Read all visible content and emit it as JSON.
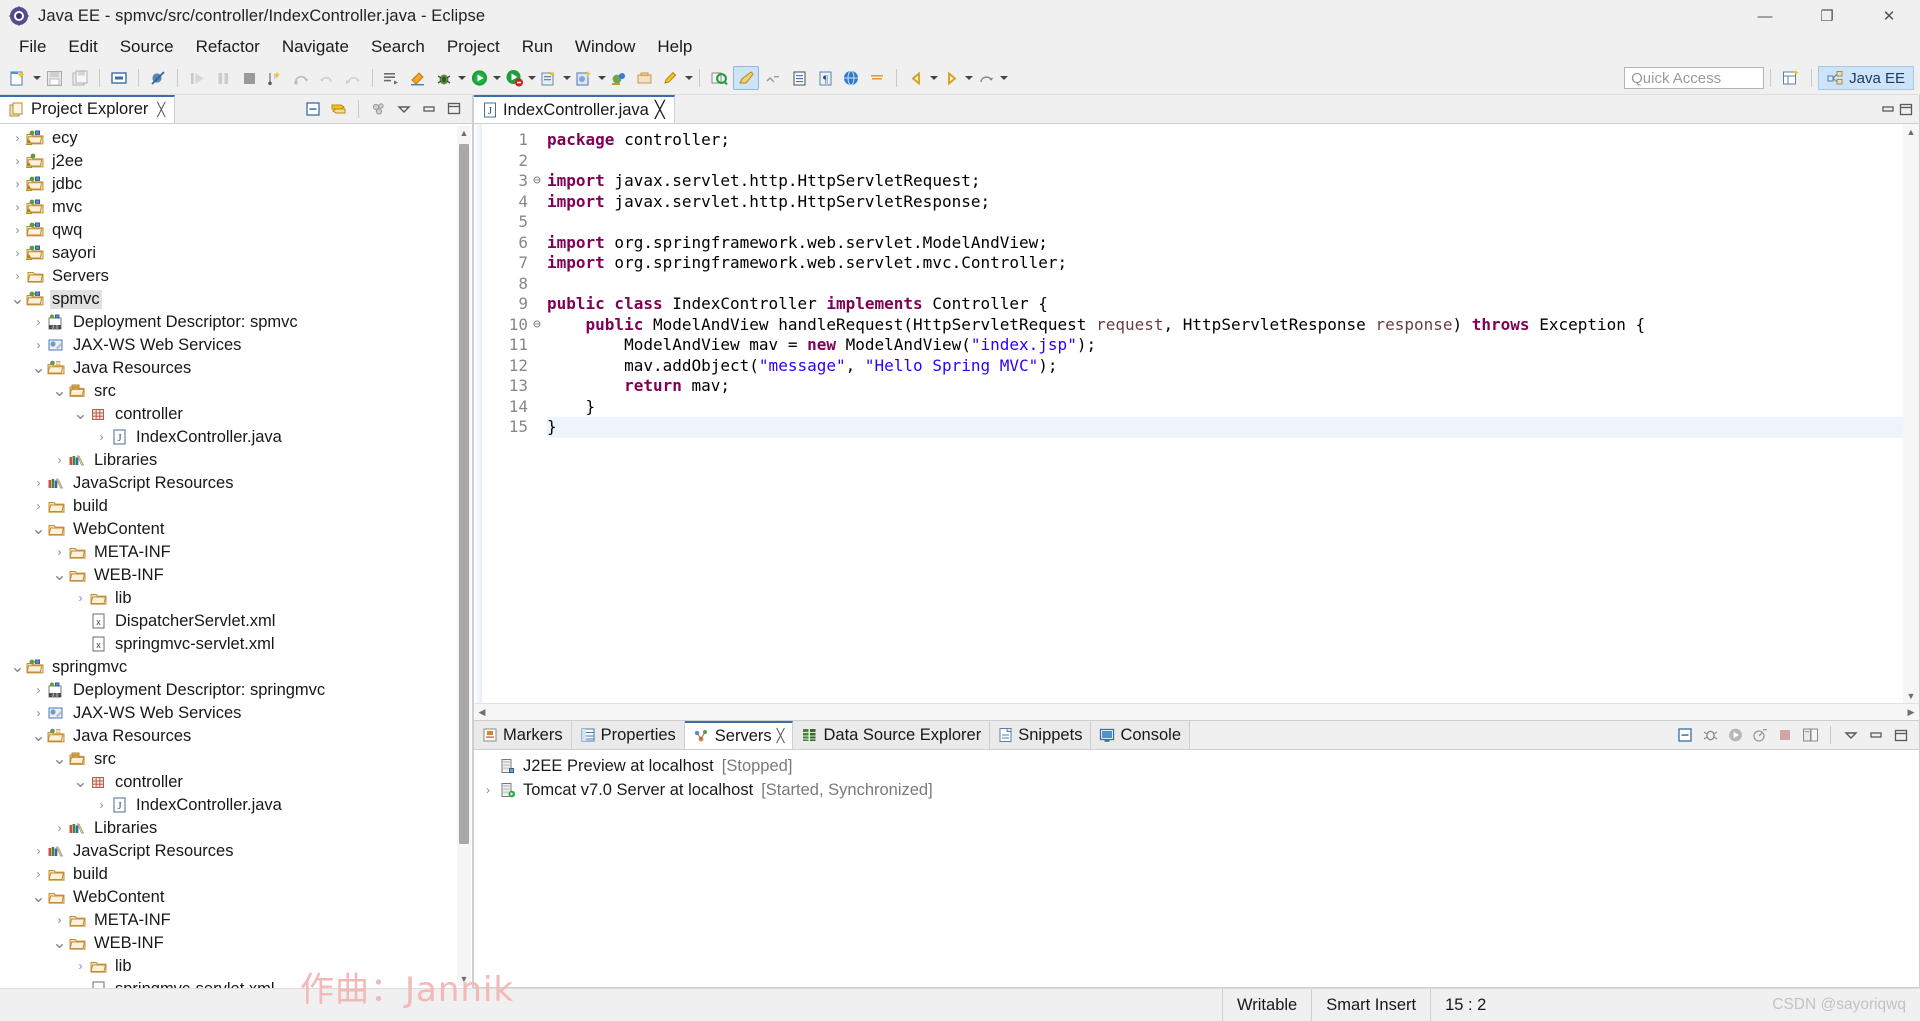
{
  "window": {
    "title": "Java EE - spmvc/src/controller/IndexController.java - Eclipse",
    "app_icon": "eclipse-icon",
    "minimize": "—",
    "maximize": "❐",
    "close": "✕"
  },
  "menubar": {
    "items": [
      "File",
      "Edit",
      "Source",
      "Refactor",
      "Navigate",
      "Search",
      "Project",
      "Run",
      "Window",
      "Help"
    ]
  },
  "toolbar": {
    "quick_access_placeholder": "Quick Access",
    "open_perspective_label": "open-perspective-icon",
    "perspective_label": "Java EE",
    "buttons": [
      "new-wizard-icon",
      "new-dropdown-caret",
      "save-icon",
      "save-all-icon",
      "print-icon",
      "skip-breakpoints-icon",
      "resume-icon",
      "suspend-icon",
      "terminate-icon",
      "step-into-icon",
      "step-over-icon",
      "step-return-icon",
      "drop-to-frame-icon",
      "open-type-icon",
      "open-task-icon",
      "debug-icon",
      "debug-caret",
      "run-icon",
      "run-caret",
      "external-tools-icon",
      "external-tools-caret",
      "coverage-icon",
      "coverage-caret",
      "new-java-package-icon",
      "new-java-class-icon",
      "new-annotation-icon",
      "annotation-caret",
      "search-icon",
      "last-edit-icon",
      "next-annotation-icon",
      "previous-annotation-icon",
      "back-icon",
      "back-caret",
      "forward-icon",
      "forward-caret",
      "pin-editor-icon"
    ]
  },
  "project_explorer": {
    "tab_label": "Project Explorer",
    "tab_icon": "project-explorer-icon",
    "close_icon": "╳",
    "toolbar_icons": [
      "collapse-all-icon",
      "link-with-editor-icon",
      "view-menu-icon",
      "minimize-icon",
      "maximize-icon"
    ],
    "tree": [
      {
        "label": "ecy",
        "indent": 0,
        "arrow": "collapsed",
        "icon": "java-web-project-warning-icon"
      },
      {
        "label": "j2ee",
        "indent": 0,
        "arrow": "collapsed",
        "icon": "web-project-warning-icon"
      },
      {
        "label": "jdbc",
        "indent": 0,
        "arrow": "collapsed",
        "icon": "java-web-project-warning-icon"
      },
      {
        "label": "mvc",
        "indent": 0,
        "arrow": "collapsed",
        "icon": "java-web-project-warning-icon"
      },
      {
        "label": "qwq",
        "indent": 0,
        "arrow": "collapsed",
        "icon": "java-web-project-icon"
      },
      {
        "label": "sayori",
        "indent": 0,
        "arrow": "collapsed",
        "icon": "java-web-project-warning-icon"
      },
      {
        "label": "Servers",
        "indent": 0,
        "arrow": "collapsed",
        "icon": "folder-icon"
      },
      {
        "label": "spmvc",
        "indent": 0,
        "arrow": "expanded",
        "icon": "java-web-project-icon",
        "selected": true
      },
      {
        "label": "Deployment Descriptor: spmvc",
        "indent": 1,
        "arrow": "collapsed",
        "icon": "deployment-descriptor-icon"
      },
      {
        "label": "JAX-WS Web Services",
        "indent": 1,
        "arrow": "collapsed",
        "icon": "jax-ws-icon"
      },
      {
        "label": "Java Resources",
        "indent": 1,
        "arrow": "expanded",
        "icon": "java-resources-icon"
      },
      {
        "label": "src",
        "indent": 2,
        "arrow": "expanded",
        "icon": "source-folder-icon"
      },
      {
        "label": "controller",
        "indent": 3,
        "arrow": "expanded",
        "icon": "package-icon"
      },
      {
        "label": "IndexController.java",
        "indent": 4,
        "arrow": "collapsed",
        "icon": "java-file-icon"
      },
      {
        "label": "Libraries",
        "indent": 2,
        "arrow": "collapsed",
        "icon": "libraries-icon"
      },
      {
        "label": "JavaScript Resources",
        "indent": 1,
        "arrow": "collapsed",
        "icon": "libraries-icon"
      },
      {
        "label": "build",
        "indent": 1,
        "arrow": "collapsed",
        "icon": "folder-icon"
      },
      {
        "label": "WebContent",
        "indent": 1,
        "arrow": "expanded",
        "icon": "folder-icon"
      },
      {
        "label": "META-INF",
        "indent": 2,
        "arrow": "collapsed",
        "icon": "folder-icon"
      },
      {
        "label": "WEB-INF",
        "indent": 2,
        "arrow": "expanded",
        "icon": "folder-icon"
      },
      {
        "label": "lib",
        "indent": 3,
        "arrow": "collapsed",
        "icon": "folder-icon"
      },
      {
        "label": "DispatcherServlet.xml",
        "indent": 3,
        "arrow": "none",
        "icon": "xml-file-icon"
      },
      {
        "label": "springmvc-servlet.xml",
        "indent": 3,
        "arrow": "none",
        "icon": "xml-file-icon"
      },
      {
        "label": "springmvc",
        "indent": 0,
        "arrow": "expanded",
        "icon": "java-web-project-icon"
      },
      {
        "label": "Deployment Descriptor: springmvc",
        "indent": 1,
        "arrow": "collapsed",
        "icon": "deployment-descriptor-icon"
      },
      {
        "label": "JAX-WS Web Services",
        "indent": 1,
        "arrow": "collapsed",
        "icon": "jax-ws-icon"
      },
      {
        "label": "Java Resources",
        "indent": 1,
        "arrow": "expanded",
        "icon": "java-resources-icon"
      },
      {
        "label": "src",
        "indent": 2,
        "arrow": "expanded",
        "icon": "source-folder-icon"
      },
      {
        "label": "controller",
        "indent": 3,
        "arrow": "expanded",
        "icon": "package-icon"
      },
      {
        "label": "IndexController.java",
        "indent": 4,
        "arrow": "collapsed",
        "icon": "java-file-icon"
      },
      {
        "label": "Libraries",
        "indent": 2,
        "arrow": "collapsed",
        "icon": "libraries-icon"
      },
      {
        "label": "JavaScript Resources",
        "indent": 1,
        "arrow": "collapsed",
        "icon": "libraries-icon"
      },
      {
        "label": "build",
        "indent": 1,
        "arrow": "collapsed",
        "icon": "folder-icon"
      },
      {
        "label": "WebContent",
        "indent": 1,
        "arrow": "expanded",
        "icon": "folder-icon"
      },
      {
        "label": "META-INF",
        "indent": 2,
        "arrow": "collapsed",
        "icon": "folder-icon"
      },
      {
        "label": "WEB-INF",
        "indent": 2,
        "arrow": "expanded",
        "icon": "folder-icon"
      },
      {
        "label": "lib",
        "indent": 3,
        "arrow": "collapsed",
        "icon": "folder-icon"
      },
      {
        "label": "springmvc-servlet.xml",
        "indent": 3,
        "arrow": "none",
        "icon": "xml-file-icon"
      }
    ]
  },
  "editor": {
    "tab_label": "IndexController.java",
    "tab_icon": "java-file-icon",
    "close_icon": "╳",
    "lines": [
      {
        "n": "1",
        "fold": "",
        "hl": false,
        "tokens": [
          {
            "t": "package",
            "c": "kw"
          },
          {
            "t": " controller;",
            "c": ""
          }
        ]
      },
      {
        "n": "2",
        "fold": "",
        "hl": false,
        "tokens": []
      },
      {
        "n": "3",
        "fold": "⊖",
        "hl": false,
        "tokens": [
          {
            "t": "import",
            "c": "kw"
          },
          {
            "t": " javax.servlet.http.HttpServletRequest;",
            "c": ""
          }
        ]
      },
      {
        "n": "4",
        "fold": "",
        "hl": false,
        "tokens": [
          {
            "t": "import",
            "c": "kw"
          },
          {
            "t": " javax.servlet.http.HttpServletResponse;",
            "c": ""
          }
        ]
      },
      {
        "n": "5",
        "fold": "",
        "hl": false,
        "tokens": []
      },
      {
        "n": "6",
        "fold": "",
        "hl": false,
        "tokens": [
          {
            "t": "import",
            "c": "kw"
          },
          {
            "t": " org.springframework.web.servlet.ModelAndView;",
            "c": ""
          }
        ]
      },
      {
        "n": "7",
        "fold": "",
        "hl": false,
        "tokens": [
          {
            "t": "import",
            "c": "kw"
          },
          {
            "t": " org.springframework.web.servlet.mvc.Controller;",
            "c": ""
          }
        ]
      },
      {
        "n": "8",
        "fold": "",
        "hl": false,
        "tokens": []
      },
      {
        "n": "9",
        "fold": "",
        "hl": false,
        "tokens": [
          {
            "t": "public class",
            "c": "kw"
          },
          {
            "t": " IndexController ",
            "c": ""
          },
          {
            "t": "implements",
            "c": "kw"
          },
          {
            "t": " Controller {",
            "c": ""
          }
        ]
      },
      {
        "n": "10",
        "fold": "⊖",
        "hl": false,
        "tokens": [
          {
            "t": "    ",
            "c": ""
          },
          {
            "t": "public",
            "c": "kw"
          },
          {
            "t": " ModelAndView handleRequest(HttpServletRequest ",
            "c": ""
          },
          {
            "t": "request",
            "c": "par"
          },
          {
            "t": ", HttpServletResponse ",
            "c": ""
          },
          {
            "t": "response",
            "c": "par"
          },
          {
            "t": ") ",
            "c": ""
          },
          {
            "t": "throws",
            "c": "kw"
          },
          {
            "t": " Exception {",
            "c": ""
          }
        ]
      },
      {
        "n": "11",
        "fold": "",
        "hl": false,
        "tokens": [
          {
            "t": "        ModelAndView mav = ",
            "c": ""
          },
          {
            "t": "new",
            "c": "kw"
          },
          {
            "t": " ModelAndView(",
            "c": ""
          },
          {
            "t": "\"index.jsp\"",
            "c": "str"
          },
          {
            "t": ");",
            "c": ""
          }
        ]
      },
      {
        "n": "12",
        "fold": "",
        "hl": false,
        "tokens": [
          {
            "t": "        mav.addObject(",
            "c": ""
          },
          {
            "t": "\"message\"",
            "c": "str"
          },
          {
            "t": ", ",
            "c": ""
          },
          {
            "t": "\"Hello Spring MVC\"",
            "c": "str"
          },
          {
            "t": ");",
            "c": ""
          }
        ]
      },
      {
        "n": "13",
        "fold": "",
        "hl": false,
        "tokens": [
          {
            "t": "        ",
            "c": ""
          },
          {
            "t": "return",
            "c": "kw"
          },
          {
            "t": " mav;",
            "c": ""
          }
        ]
      },
      {
        "n": "14",
        "fold": "",
        "hl": false,
        "tokens": [
          {
            "t": "    }",
            "c": ""
          }
        ]
      },
      {
        "n": "15",
        "fold": "",
        "hl": true,
        "tokens": [
          {
            "t": "}",
            "c": ""
          }
        ]
      }
    ]
  },
  "bottom_panel": {
    "tabs": [
      {
        "label": "Markers",
        "icon": "markers-icon",
        "active": false
      },
      {
        "label": "Properties",
        "icon": "properties-icon",
        "active": false
      },
      {
        "label": "Servers",
        "icon": "servers-icon",
        "active": true,
        "close_icon": "╳"
      },
      {
        "label": "Data Source Explorer",
        "icon": "data-source-icon",
        "active": false
      },
      {
        "label": "Snippets",
        "icon": "snippets-icon",
        "active": false
      },
      {
        "label": "Console",
        "icon": "console-icon",
        "active": false
      }
    ],
    "toolbar_icons": [
      "collapse-all-icon",
      "debug-server-icon",
      "start-server-icon",
      "profile-server-icon",
      "stop-server-icon",
      "publish-icon",
      "view-menu-icon",
      "minimize-icon",
      "maximize-icon"
    ],
    "servers": [
      {
        "name": "J2EE Preview at localhost",
        "state": "[Stopped]",
        "arrow": "none",
        "icon": "server-stopped-icon"
      },
      {
        "name": "Tomcat v7.0 Server at localhost",
        "state": "[Started, Synchronized]",
        "arrow": "collapsed",
        "icon": "server-started-icon"
      }
    ]
  },
  "statusbar": {
    "writable": "Writable",
    "insert_mode": "Smart Insert",
    "position": "15 : 2",
    "watermark_right": "CSDN @sayoriqwq"
  },
  "watermark": "作曲：Jannik",
  "colors": {
    "accent": "#3a6ea5",
    "keyword": "#7f0055",
    "string": "#2a00ff",
    "parameter": "#6a3e3e",
    "selection": "#eef4fc",
    "chrome": "#f0f0f0"
  }
}
